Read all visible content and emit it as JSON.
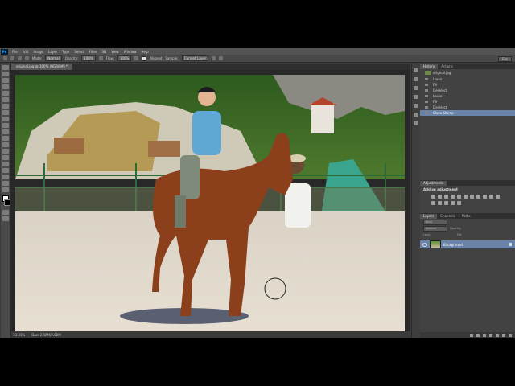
{
  "menubar": {
    "logo": "Ps",
    "items": [
      "File",
      "Edit",
      "Image",
      "Layer",
      "Type",
      "Select",
      "Filter",
      "3D",
      "View",
      "Window",
      "Help"
    ]
  },
  "options": {
    "mode_label": "Mode:",
    "mode_value": "Normal",
    "opacity_label": "Opacity:",
    "opacity_value": "100%",
    "flow_label": "Flow:",
    "flow_value": "100%",
    "aligned_label": "Aligned",
    "sample_label": "Sample:",
    "sample_value": "Current Layer",
    "workspace": "Ess"
  },
  "document": {
    "tab_title": "original.jpg @ 100% (RGB/8#) *"
  },
  "status": {
    "zoom": "33.33%",
    "doc_info": "Doc: 2.00M/2.00M"
  },
  "history": {
    "tabs": [
      "History",
      "Actions"
    ],
    "snapshot": "original.jpg",
    "items": [
      {
        "label": "Lasso",
        "selected": false
      },
      {
        "label": "Fill",
        "selected": false
      },
      {
        "label": "Deselect",
        "selected": false
      },
      {
        "label": "Lasso",
        "selected": false
      },
      {
        "label": "Fill",
        "selected": false
      },
      {
        "label": "Deselect",
        "selected": false
      },
      {
        "label": "Clone Stamp",
        "selected": true
      }
    ]
  },
  "adjustments": {
    "tab": "Adjustments",
    "title": "Add an adjustment"
  },
  "layers": {
    "tabs": [
      "Layers",
      "Channels",
      "Paths"
    ],
    "kind_label": "Kind",
    "blend_value": "Normal",
    "opacity_label": "Opacity:",
    "lock_label": "Lock:",
    "fill_label": "Fill:",
    "layer_name": "Background"
  },
  "colors": {
    "selected": "#6a83a8",
    "panel_bg": "#424242",
    "app_bg": "#3c3c3c"
  }
}
